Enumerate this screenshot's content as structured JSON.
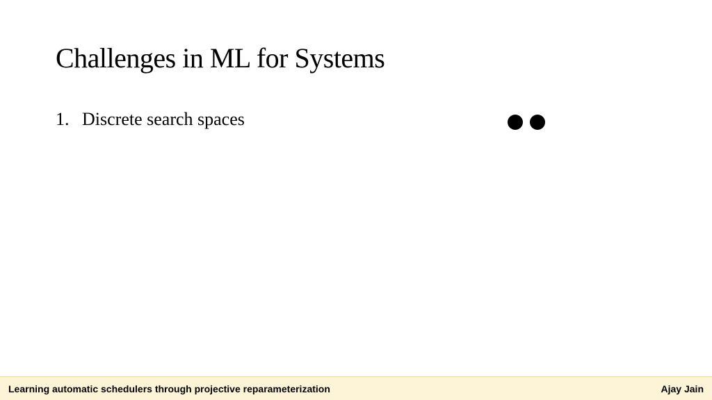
{
  "slide": {
    "title": "Challenges in ML for Systems",
    "list": [
      {
        "number": "1.",
        "text": "Discrete search spaces"
      }
    ]
  },
  "footer": {
    "left": "Learning automatic schedulers through projective reparameterization",
    "right": "Ajay Jain"
  }
}
